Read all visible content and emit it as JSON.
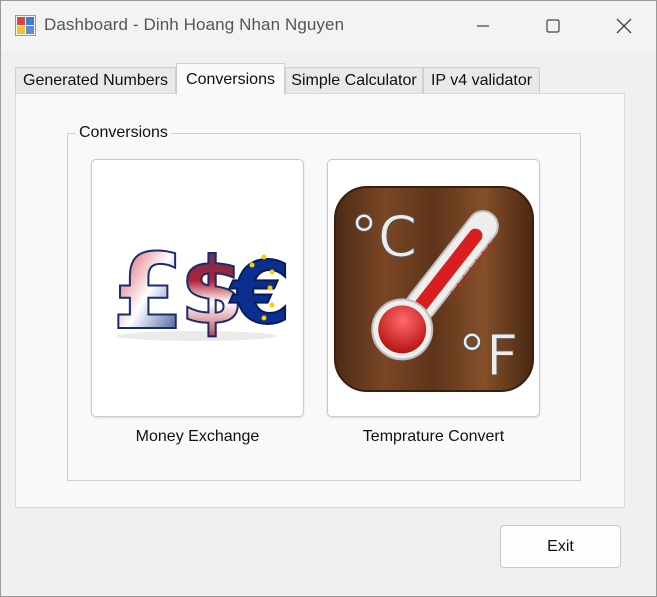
{
  "window": {
    "title": "Dashboard - Dinh Hoang Nhan Nguyen",
    "controls": {
      "minimize_icon": "minimize-icon",
      "maximize_icon": "maximize-icon",
      "close_icon": "close-icon"
    }
  },
  "tabs": [
    {
      "label": "Generated Numbers",
      "active": false
    },
    {
      "label": "Conversions",
      "active": true
    },
    {
      "label": "Simple Calculator",
      "active": false
    },
    {
      "label": "IP v4 validator",
      "active": false
    }
  ],
  "conversions": {
    "group_title": "Conversions",
    "tiles": [
      {
        "label": "Money Exchange",
        "icon": "currency-symbols-icon"
      },
      {
        "label": "Temprature Convert",
        "icon": "thermometer-icon",
        "celsius_text": "°C",
        "fahrenheit_text": "°F"
      }
    ]
  },
  "footer": {
    "exit_label": "Exit"
  },
  "colors": {
    "window_bg": "#f0f0f0",
    "panel_bg": "#f9f9f9",
    "temp_wood": "#6b3d1f",
    "thermo_red": "#d81e1e"
  }
}
